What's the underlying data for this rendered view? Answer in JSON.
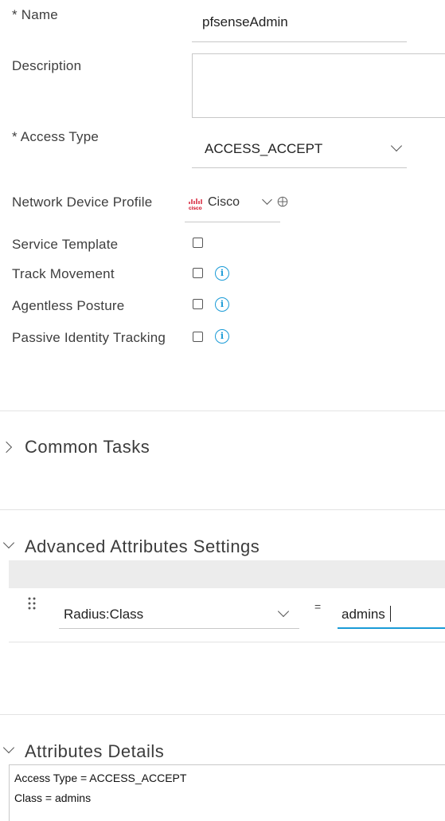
{
  "form": {
    "name_label": "* Name",
    "name_value": "pfsenseAdmin",
    "description_label": "Description",
    "description_value": "",
    "access_type_label": "* Access Type",
    "access_type_value": "ACCESS_ACCEPT",
    "ndp_label": "Network Device Profile",
    "ndp_logo_text": "cisco",
    "ndp_value": "Cisco",
    "service_template_label": "Service Template",
    "service_template_checked": false,
    "track_movement_label": "Track Movement",
    "track_movement_checked": false,
    "agentless_posture_label": "Agentless Posture",
    "agentless_posture_checked": false,
    "passive_identity_label": "Passive Identity Tracking",
    "passive_identity_checked": false,
    "info_glyph": "i"
  },
  "sections": {
    "common_tasks": "Common Tasks",
    "advanced_attributes": "Advanced Attributes Settings",
    "attributes_details": "Attributes Details"
  },
  "advanced": {
    "attribute_name": "Radius:Class",
    "operator": "=",
    "attribute_value": "admins"
  },
  "details": {
    "line1": "Access Type = ACCESS_ACCEPT",
    "line2": "Class = admins"
  },
  "colors": {
    "accent": "#1a9bd7",
    "cisco_logo": "#d0021b"
  }
}
